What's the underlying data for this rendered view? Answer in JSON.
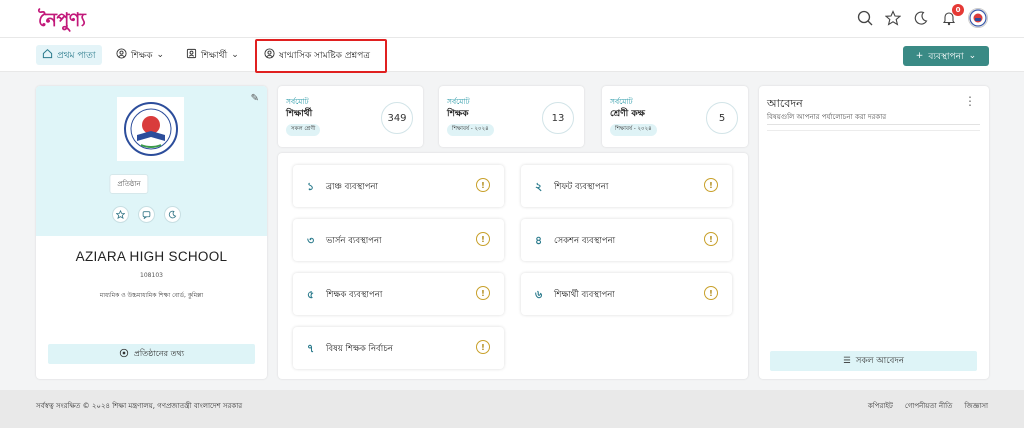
{
  "header": {
    "logo": "নৈপুণ্য",
    "notification_count": "0"
  },
  "nav": {
    "home": "প্রথম পাতা",
    "teacher": "শিক্ষক",
    "student": "শিক্ষার্থী",
    "exam": "ষাণ্মাসিক সামষ্টিক প্রশ্নপত্র",
    "manage_button": "ব্যবস্থাপনা"
  },
  "profile": {
    "badge": "প্রতিষ্ঠান",
    "school_name": "AZIARA HIGH SCHOOL",
    "eiin": "108103",
    "board": "মাধ্যমিক ও উচ্চমাধ্যমিক শিক্ষা বোর্ড, কুমিল্লা",
    "info_button": "প্রতিষ্ঠানের তথ্য"
  },
  "stats": [
    {
      "top": "সর্বমোট",
      "title": "শিক্ষার্থী",
      "chip": "সকল শ্রেণী",
      "value": "349"
    },
    {
      "top": "সর্বমোট",
      "title": "শিক্ষক",
      "chip": "শিক্ষাবর্ষ - ২০২৪",
      "value": "13"
    },
    {
      "top": "সর্বমোট",
      "title": "শ্রেণী কক্ষ",
      "chip": "শিক্ষাবর্ষ - ২০২৪",
      "value": "5"
    }
  ],
  "management": [
    {
      "num": "১",
      "label": "ব্রাঞ্চ ব্যবস্থাপনা"
    },
    {
      "num": "২",
      "label": "শিফট ব্যবস্থাপনা"
    },
    {
      "num": "৩",
      "label": "ভার্সন ব্যবস্থাপনা"
    },
    {
      "num": "৪",
      "label": "সেকশন ব্যবস্থাপনা"
    },
    {
      "num": "৫",
      "label": "শিক্ষক ব্যবস্থাপনা"
    },
    {
      "num": "৬",
      "label": "শিক্ষার্থী ব্যবস্থাপনা"
    },
    {
      "num": "৭",
      "label": "বিষয় শিক্ষক নির্বাচন"
    }
  ],
  "applications": {
    "title": "আবেদন",
    "subtitle": "বিষয়গুলি আপনার পর্যালোচনা করা দরকার",
    "all_button": "সকল আবেদন"
  },
  "footer": {
    "copyright": "সর্বস্বত্ব সংরক্ষিত © ২০২৪ শিক্ষা মন্ত্রণালয়, গণপ্রজাতন্ত্রী বাংলাদেশ সরকার",
    "links": [
      "কপিরাইট",
      "গোপনীয়তা নীতি",
      "জিজ্ঞাসা"
    ]
  },
  "colors": {
    "accent": "#3a8a85",
    "logo": "#c2187a",
    "highlight": "#e02020"
  }
}
